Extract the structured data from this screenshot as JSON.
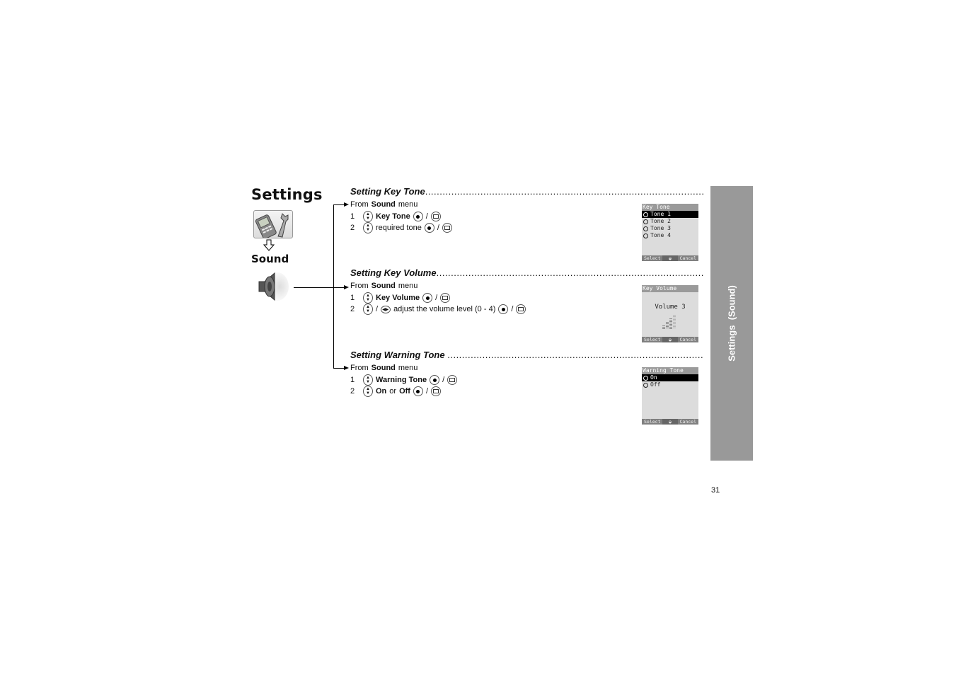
{
  "chapter": {
    "title": "Settings",
    "submenu": "Sound",
    "settings_icon": "phone-wrench-icon",
    "down_arrow_icon": "down-arrow-icon",
    "sound_icon": "speaker-icon"
  },
  "sections": [
    {
      "title": "Setting Key Tone",
      "from_prefix": "From",
      "from_bold": "Sound",
      "from_suffix": "menu",
      "steps": [
        {
          "num": "1",
          "parts": [
            {
              "bold": "Key Tone"
            }
          ]
        },
        {
          "num": "2",
          "parts": [
            {
              "text": "required tone"
            }
          ]
        }
      ],
      "screen": {
        "title": "Key Tone",
        "options": [
          "Tone 1",
          "Tone 2",
          "Tone 3",
          "Tone 4"
        ],
        "selected": "Tone 1",
        "softkey_left": "Select",
        "softkey_right": "Cancel"
      }
    },
    {
      "title": "Setting Key Volume",
      "from_prefix": "From",
      "from_bold": "Sound",
      "from_suffix": "menu",
      "steps": [
        {
          "num": "1",
          "parts": [
            {
              "bold": "Key Volume"
            }
          ]
        },
        {
          "num": "2",
          "parts": [
            {
              "text": "adjust the volume level (0 - 4)"
            }
          ]
        }
      ],
      "screen": {
        "title": "Key Volume",
        "volume_label": "Volume 3",
        "volume_level": 3,
        "volume_max": 4,
        "softkey_left": "Select",
        "softkey_right": "Cancel"
      }
    },
    {
      "title": "Setting Warning Tone",
      "from_prefix": "From",
      "from_bold": "Sound",
      "from_suffix": "menu",
      "steps": [
        {
          "num": "1",
          "parts": [
            {
              "bold": "Warning Tone"
            }
          ]
        },
        {
          "num": "2",
          "parts": [
            {
              "bold": "On"
            },
            {
              "text": "or"
            },
            {
              "bold": "Off"
            }
          ]
        }
      ],
      "screen": {
        "title": "Warning Tone",
        "options": [
          "On",
          "Off"
        ],
        "selected": "On",
        "softkey_left": "Select",
        "softkey_right": "Cancel"
      }
    }
  ],
  "separator": "/",
  "side_tab": "Settings  (Sound)",
  "page_number": "31",
  "dots": "..................................................................................................................................................."
}
